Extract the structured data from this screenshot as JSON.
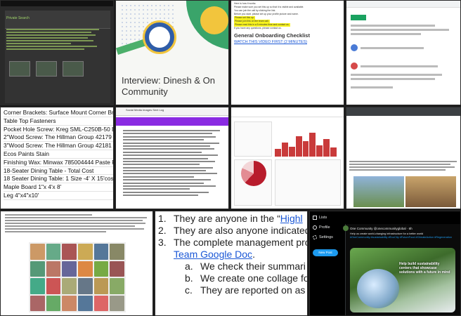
{
  "tile1": {
    "title": "Private Search"
  },
  "tile2": {
    "heading": "Interview: Dinesh & On Community"
  },
  "tile3": {
    "intro_lines": [
      "Here is how it works:",
      "Please make sure you set this up so that it is visible and available.",
      "You can join the call by clicking the link.",
      "Before you start, please set up your profile picture and name.",
      "If you have any questions, please contact us."
    ],
    "highlight1": "Please set this up:",
    "highlight2": "Please join this on the team call.",
    "highlight3": "Please read this in a 5 minutes time and contact us.",
    "section_heading": "General Onboarding Checklist",
    "video_link": "WATCH THIS VIDEO FIRST (2 MINUTES)"
  },
  "tile5": {
    "rows": [
      "Corner Brackets: Surface Mount Corner Brackets",
      "Table Top Fasteners",
      "Pocket Hole Screw: Kreg SML-C250B-50 B",
      "2\"Wood Screw: The Hillman Group 42179",
      "3\"Wood Screw: The Hillman Group 42181",
      "Ecos Paints Stain",
      "Finishing Wax: Minwax 785004444 Paste F",
      "18-Seater Dining Table - Total Cost",
      "18 Seater Dining Table: 1 Size -4' X 15'cost",
      "Maple Board 1\"x 4'x 8'",
      "Leg 4\"x4\"x10'"
    ]
  },
  "tile6": {
    "title": "Social Media Images Sent Log"
  },
  "tile10": {
    "items": [
      {
        "num": "1.",
        "text": "They are anyone in the “",
        "link": "Highl"
      },
      {
        "num": "2.",
        "text": "They are also anyone indicated"
      },
      {
        "num": "3.",
        "text": "The complete management pro"
      }
    ],
    "team_link": "Team Google Doc",
    "subitems": [
      {
        "num": "a.",
        "text": "We check their summari"
      },
      {
        "num": "b.",
        "text": "We create one collage fo"
      },
      {
        "num": "c.",
        "text": "They are reported on as"
      }
    ]
  },
  "tile11": {
    "nav": [
      "Lists",
      "Profile",
      "Settings"
    ],
    "new_post": "New Post",
    "author": "One Community @onecommunityglobal · 6h",
    "post_text": "Help us create world-changing infrastructure for a better world",
    "tags": "#OneCommunity #sustainability #EcoCity #FutureFood #ClimateAction #Regeneration",
    "image_text": "Help build sustainability centers that showcase solutions with a future in mind"
  },
  "colors": {
    "accent_blue": "#1d9bf0",
    "highlight_yellow": "#f7f21e",
    "doc_purple": "#8a2be2",
    "chart_red": "#b81c2c"
  }
}
